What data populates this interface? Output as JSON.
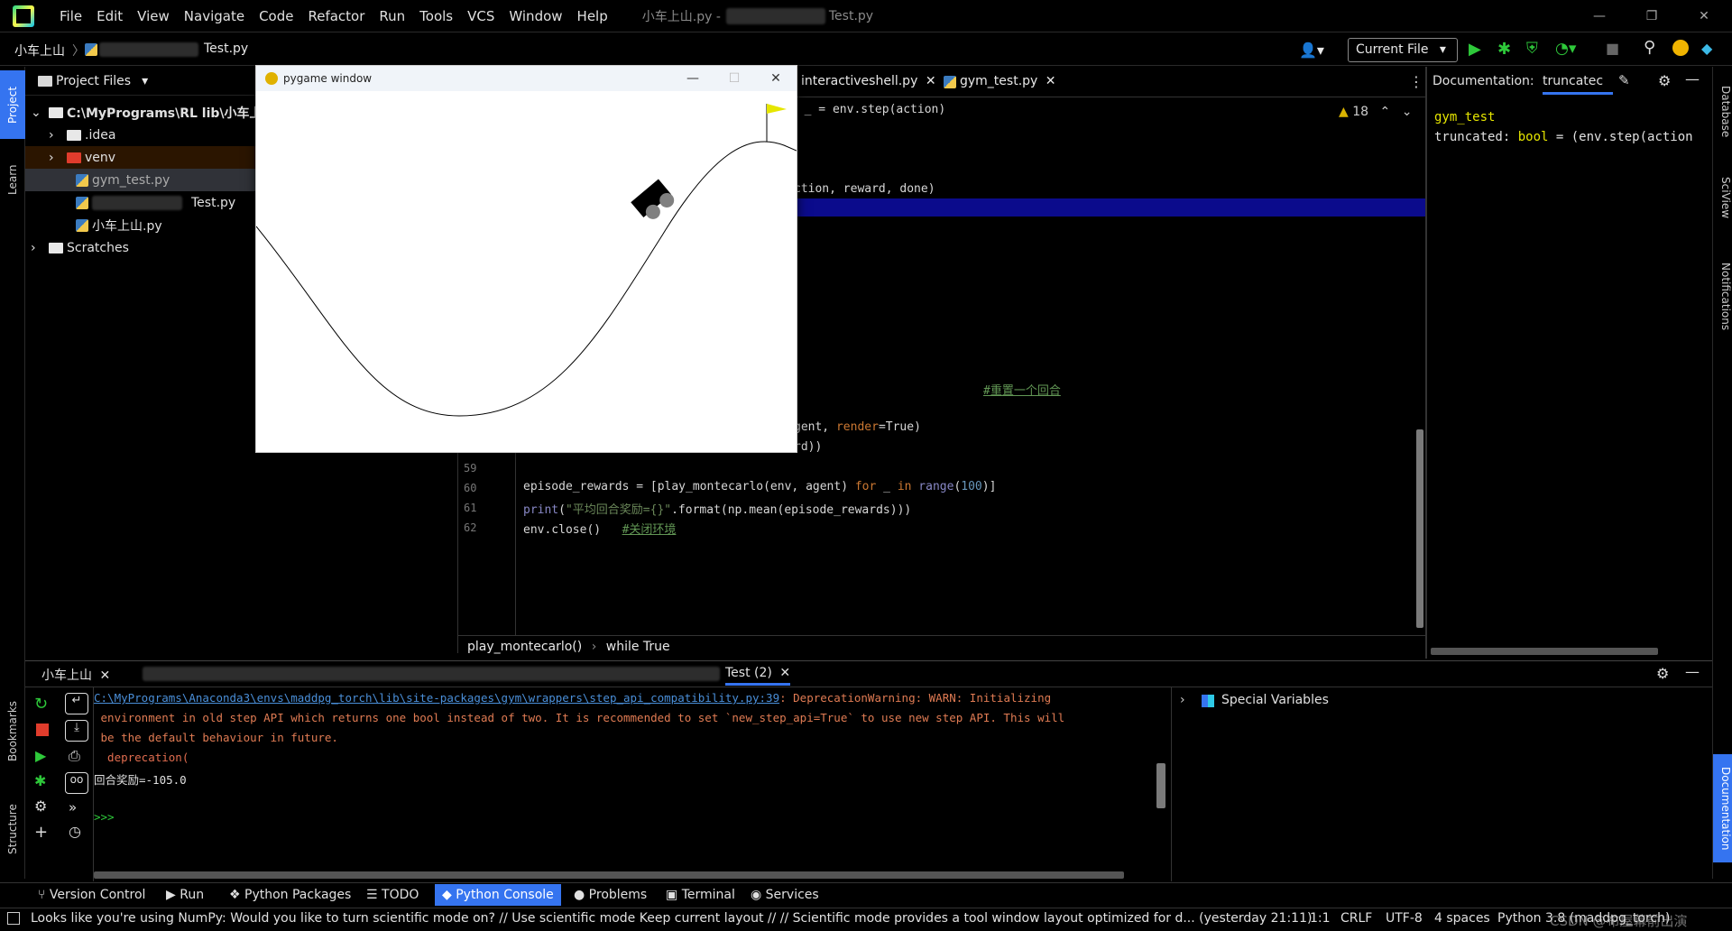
{
  "titlebar": {
    "menu": [
      "File",
      "Edit",
      "View",
      "Navigate",
      "Code",
      "Refactor",
      "Run",
      "Tools",
      "VCS",
      "Window",
      "Help"
    ],
    "title_prefix": "小车上山.py -",
    "title_suffix": "Test.py"
  },
  "navbar": {
    "project": "小车上山",
    "file": "Test.py",
    "run_config": "Current File"
  },
  "left_strip": {
    "project_tab": "Project",
    "learn_tab": "Learn",
    "bookmarks_tab": "Bookmarks",
    "structure_tab": "Structure"
  },
  "right_strip": {
    "database_tab": "Database",
    "sciview_tab": "SciView",
    "notifications_tab": "Notifications",
    "documentation_tab": "Documentation"
  },
  "project": {
    "header": "Project Files",
    "root": "C:\\MyPrograms\\RL lib\\小车上",
    "items": [
      ".idea",
      "venv",
      "gym_test.py",
      "Test.py",
      "小车上山.py",
      "Scratches"
    ]
  },
  "editor": {
    "tabs": [
      "interactiveshell.py",
      "gym_test.py"
    ],
    "warnings": "18",
    "code": {
      "l1": ", _ = env.step(action)",
      "l2": "ction, reward, done)",
      "comment_reset": "#重置一个回合",
      "l3_a": "gent, ",
      "l3_b": "render",
      "l3_c": "=True)",
      "l4": "rd))",
      "ln59": "59",
      "ln60": "60",
      "ln61": "61",
      "ln62": "62",
      "l60_a": "episode_rewards = [play_montecarlo(env, agent) ",
      "l60_for": "for",
      "l60_b": " _ ",
      "l60_in": "in",
      "l60_range": " range",
      "l60_num": "100",
      "l60_c": ")]",
      "l61_print": "print",
      "l61_str": "\"平均回合奖励={}\"",
      "l61_b": ".format(np.mean(episode_rewards)))",
      "l62_a": "env.close()   ",
      "l62_comment": "#关闭环境"
    },
    "breadcrumb": [
      "play_montecarlo()",
      "while True"
    ]
  },
  "doc": {
    "label": "Documentation:",
    "tab": "truncatec",
    "line1": "gym_test",
    "line2_a": "truncated: ",
    "line2_b": "bool",
    "line2_c": " = (env.step(action"
  },
  "console": {
    "tab1": "小车上山",
    "tab2": "Test (2)",
    "link": "C:\\MyPrograms\\Anaconda3\\envs\\maddpg_torch\\lib\\site-packages\\gym\\wrappers\\step_api_compatibility.py:39",
    "warn_head": ": DeprecationWarning: WARN: Initializing",
    "warn2": " environment in old step API which returns one bool instead of two. It is recommended to set `new_step_api=True` to use new step API. This will",
    "warn3": " be the default behaviour in future.",
    "warn4": "  deprecation(",
    "result": "回合奖励=-105.0",
    "prompt": ">>>",
    "variables": "Special Variables"
  },
  "bottom_tabs": [
    "Version Control",
    "Run",
    "Python Packages",
    "TODO",
    "Python Console",
    "Problems",
    "Terminal",
    "Services"
  ],
  "status": {
    "message": "Looks like you're using NumPy: Would you like to turn scientific mode on? // Use scientific mode   Keep current layout // // Scientific mode provides a tool window layout optimized for d... (yesterday 21:11)",
    "pos": "1:1",
    "crlf": "CRLF",
    "enc": "UTF-8",
    "indent": "4 spaces",
    "interp": "Python 3.8 (maddpg_torch)",
    "watermark": "CSDN @布屋幕前出演"
  },
  "pygame": {
    "title": "pygame window"
  },
  "colors": {
    "accent": "#3574f0",
    "keyword": "#cc7832",
    "string": "#6a8759",
    "number": "#6897bb",
    "selection": "#0b0b8c"
  }
}
